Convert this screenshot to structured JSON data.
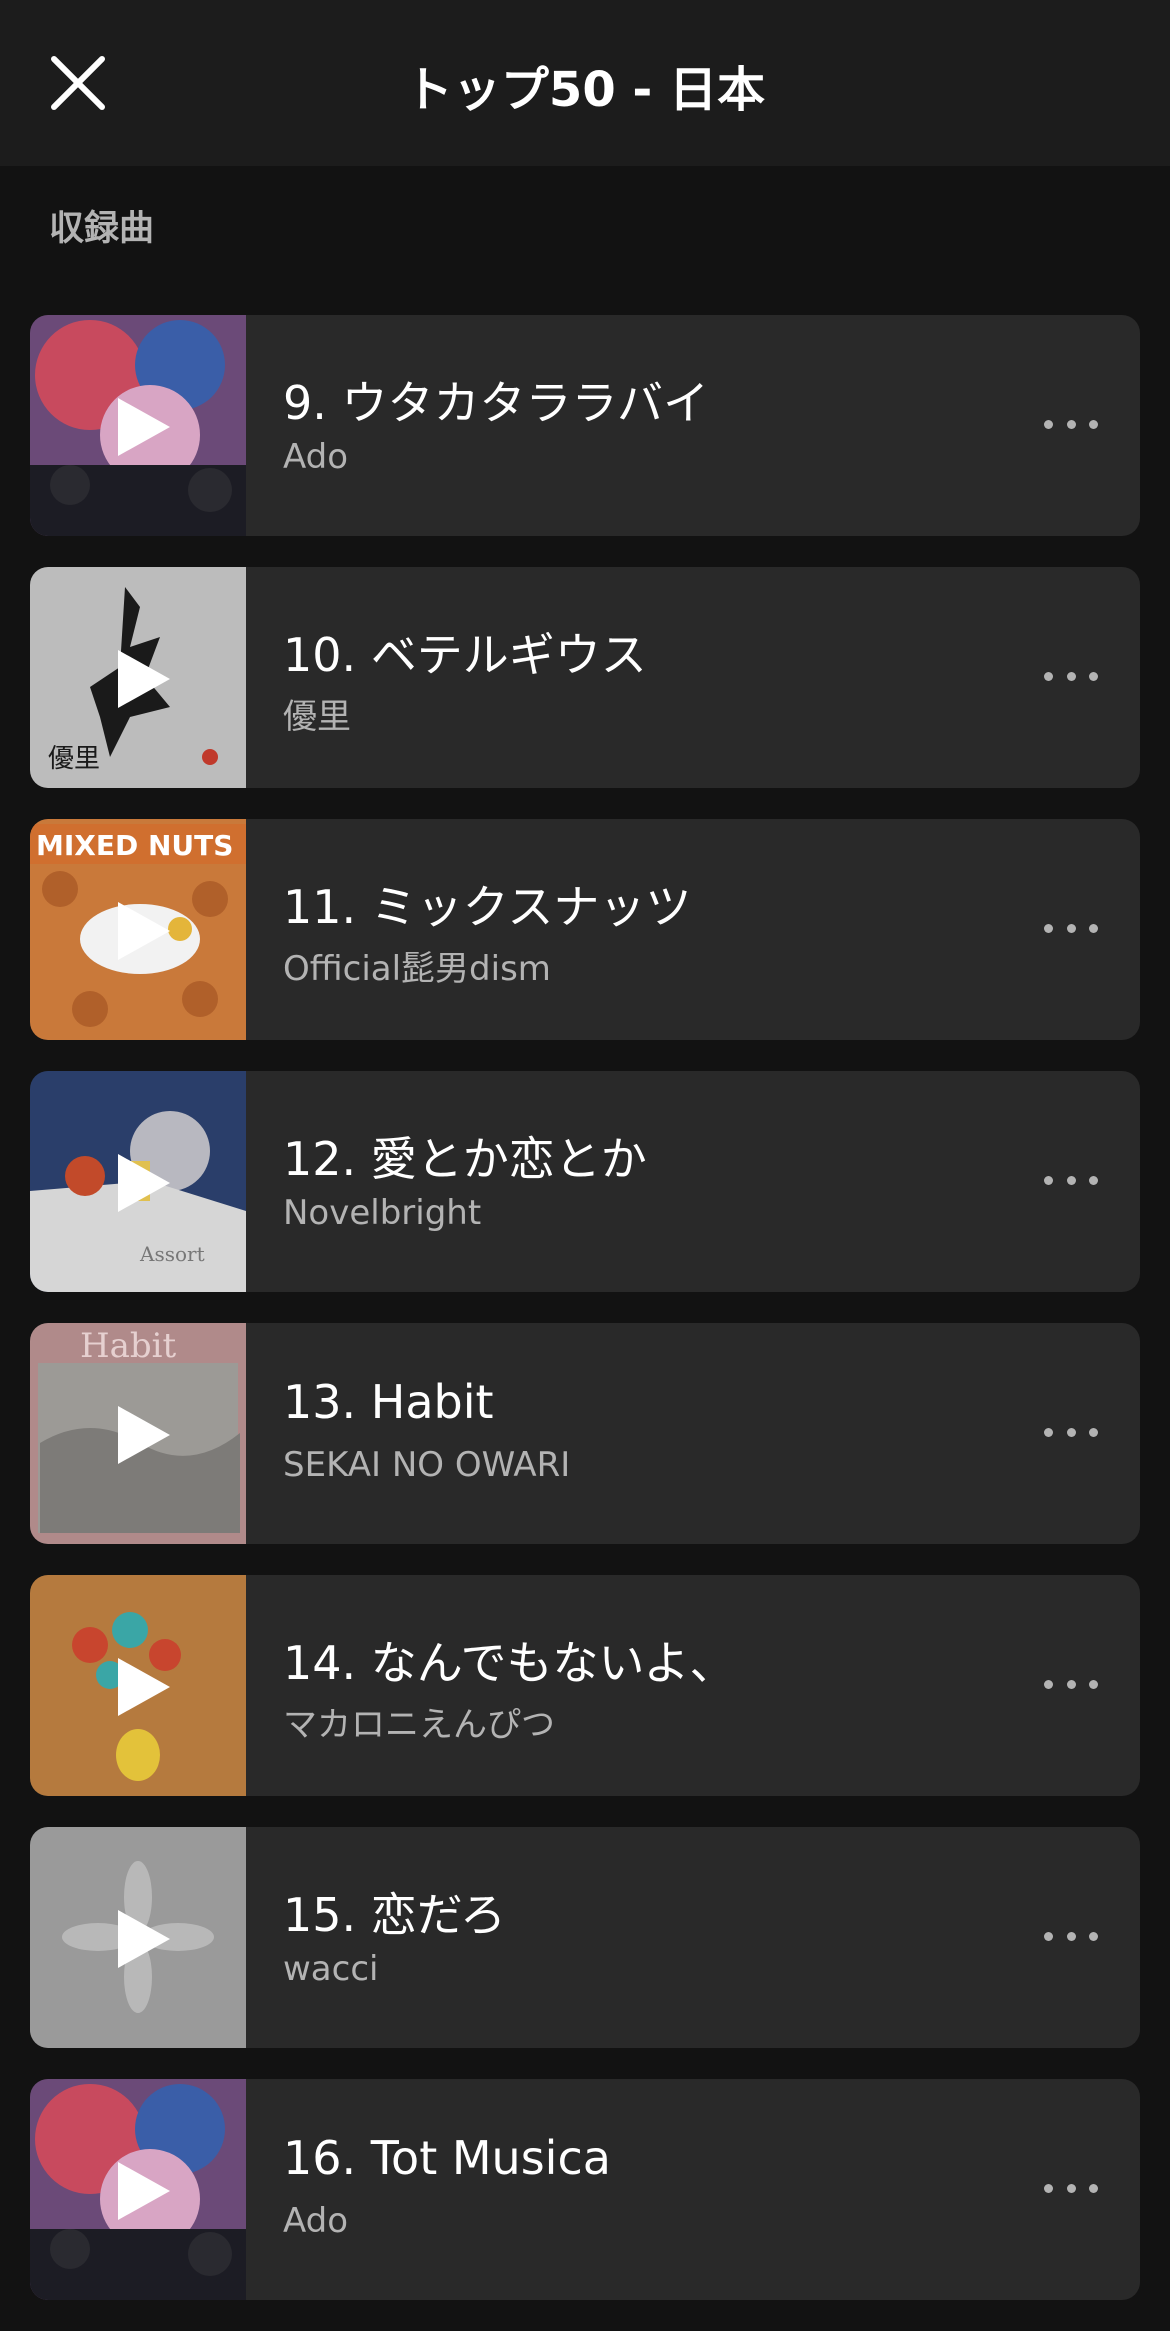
{
  "header": {
    "title": "トップ50 - 日本",
    "close_icon": "close-icon"
  },
  "section": {
    "label": "収録曲"
  },
  "tracks": [
    {
      "title": "9. ウタカタララバイ",
      "artist": "Ado",
      "art": "one-piece-film-red-art"
    },
    {
      "title": "10. ベテルギウス",
      "artist": "優里",
      "art": "yuuri-calligraphy-art"
    },
    {
      "title": "11. ミックスナッツ",
      "artist": "Official髭男dism",
      "art": "mixed-nuts-art"
    },
    {
      "title": "12. 愛とか恋とか",
      "artist": "Novelbright",
      "art": "assort-box-art"
    },
    {
      "title": "13. Habit",
      "artist": "SEKAI NO OWARI",
      "art": "habit-art"
    },
    {
      "title": "14. なんでもないよ、",
      "artist": "マカロニえんぴつ",
      "art": "balloon-flower-art"
    },
    {
      "title": "15. 恋だろ",
      "artist": "wacci",
      "art": "grey-hands-art"
    },
    {
      "title": "16. Tot Musica",
      "artist": "Ado",
      "art": "one-piece-film-red-art"
    }
  ]
}
